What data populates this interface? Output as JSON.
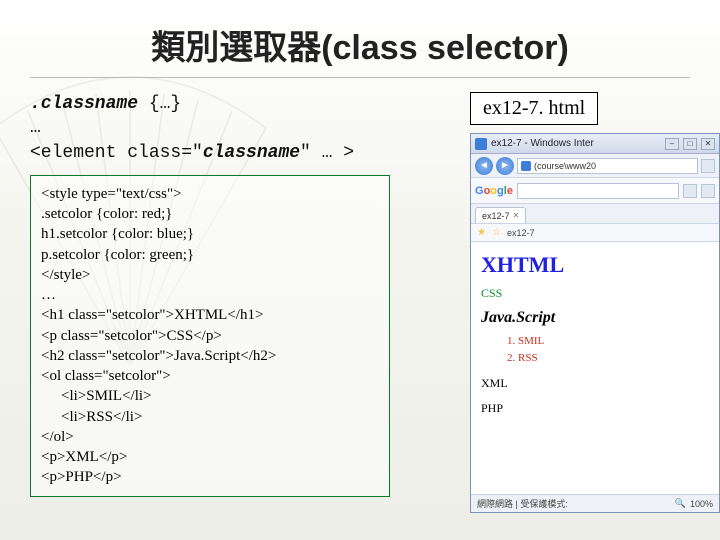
{
  "title": "類別選取器(class selector)",
  "syntax": {
    "line1a": ".classname",
    "line1b": " {…}",
    "line2": "…",
    "line3a": "<element class=\"",
    "line3b": "classname",
    "line3c": "\" … >"
  },
  "code": {
    "l1": "<style type=\"text/css\">",
    "l2": ".setcolor {color: red;}",
    "l3": "h1.setcolor {color: blue;}",
    "l4": "p.setcolor {color: green;}",
    "l5": "</style>",
    "l6": "…",
    "l7": "<h1 class=\"setcolor\">XHTML</h1>",
    "l8": "<p class=\"setcolor\">CSS</p>",
    "l9": "<h2 class=\"setcolor\">Java.Script</h2>",
    "l10": "<ol class=\"setcolor\">",
    "l11": "<li>SMIL</li>",
    "l12": "<li>RSS</li>",
    "l13": "</ol>",
    "l14": "<p>XML</p>",
    "l15": "<p>PHP</p>"
  },
  "file_label": "ex12-7. html",
  "browser": {
    "window_title": "ex12-7 - Windows Inter",
    "address_text": "(course\\www20",
    "tab_label": "ex12-7",
    "fav_label": "ex12-7",
    "google_label": "Google",
    "content": {
      "h1": "XHTML",
      "css": "CSS",
      "h2": "Java.Script",
      "ol": [
        "1.   SMIL",
        "2.   RSS"
      ],
      "xml": "XML",
      "php": "PHP"
    },
    "status_left": "網際網路 | 受保護模式:",
    "zoom": "100%"
  }
}
